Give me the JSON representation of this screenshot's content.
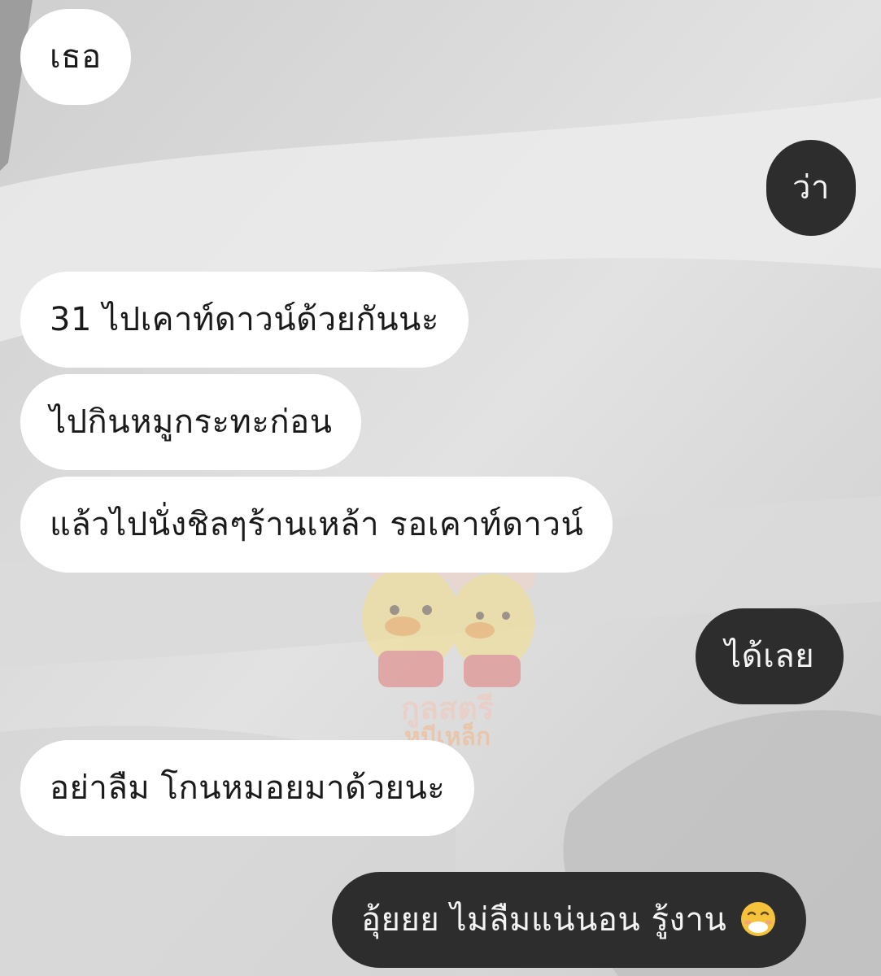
{
  "messages": [
    {
      "side": "in",
      "text": "เธอ"
    },
    {
      "side": "out",
      "text": "ว่า"
    },
    {
      "side": "in",
      "text": "31 ไปเคาท์ดาวน์ด้วยกันนะ"
    },
    {
      "side": "in",
      "text": "ไปกินหมูกระทะก่อน"
    },
    {
      "side": "in",
      "text": "แล้วไปนั่งชิลๆร้านเหล้า รอเคาท์ดาวน์"
    },
    {
      "side": "out",
      "text": "ได้เลย"
    },
    {
      "side": "in",
      "text": "อย่าลืม โกนหมอยมาด้วยนะ"
    },
    {
      "side": "out",
      "text": "อุ้ยยย ไม่ลืมแน่นอน รู้งาน",
      "emoji": "face-with-hand-over-mouth-icon"
    }
  ],
  "watermark": {
    "line1": "กูลสตรี",
    "line2": "หมีเหล็ก"
  },
  "colors": {
    "incoming_bubble": "#ffffff",
    "outgoing_bubble": "#2d2d2d",
    "outgoing_text": "#f4f4f4",
    "incoming_text": "#1a1a1a"
  }
}
